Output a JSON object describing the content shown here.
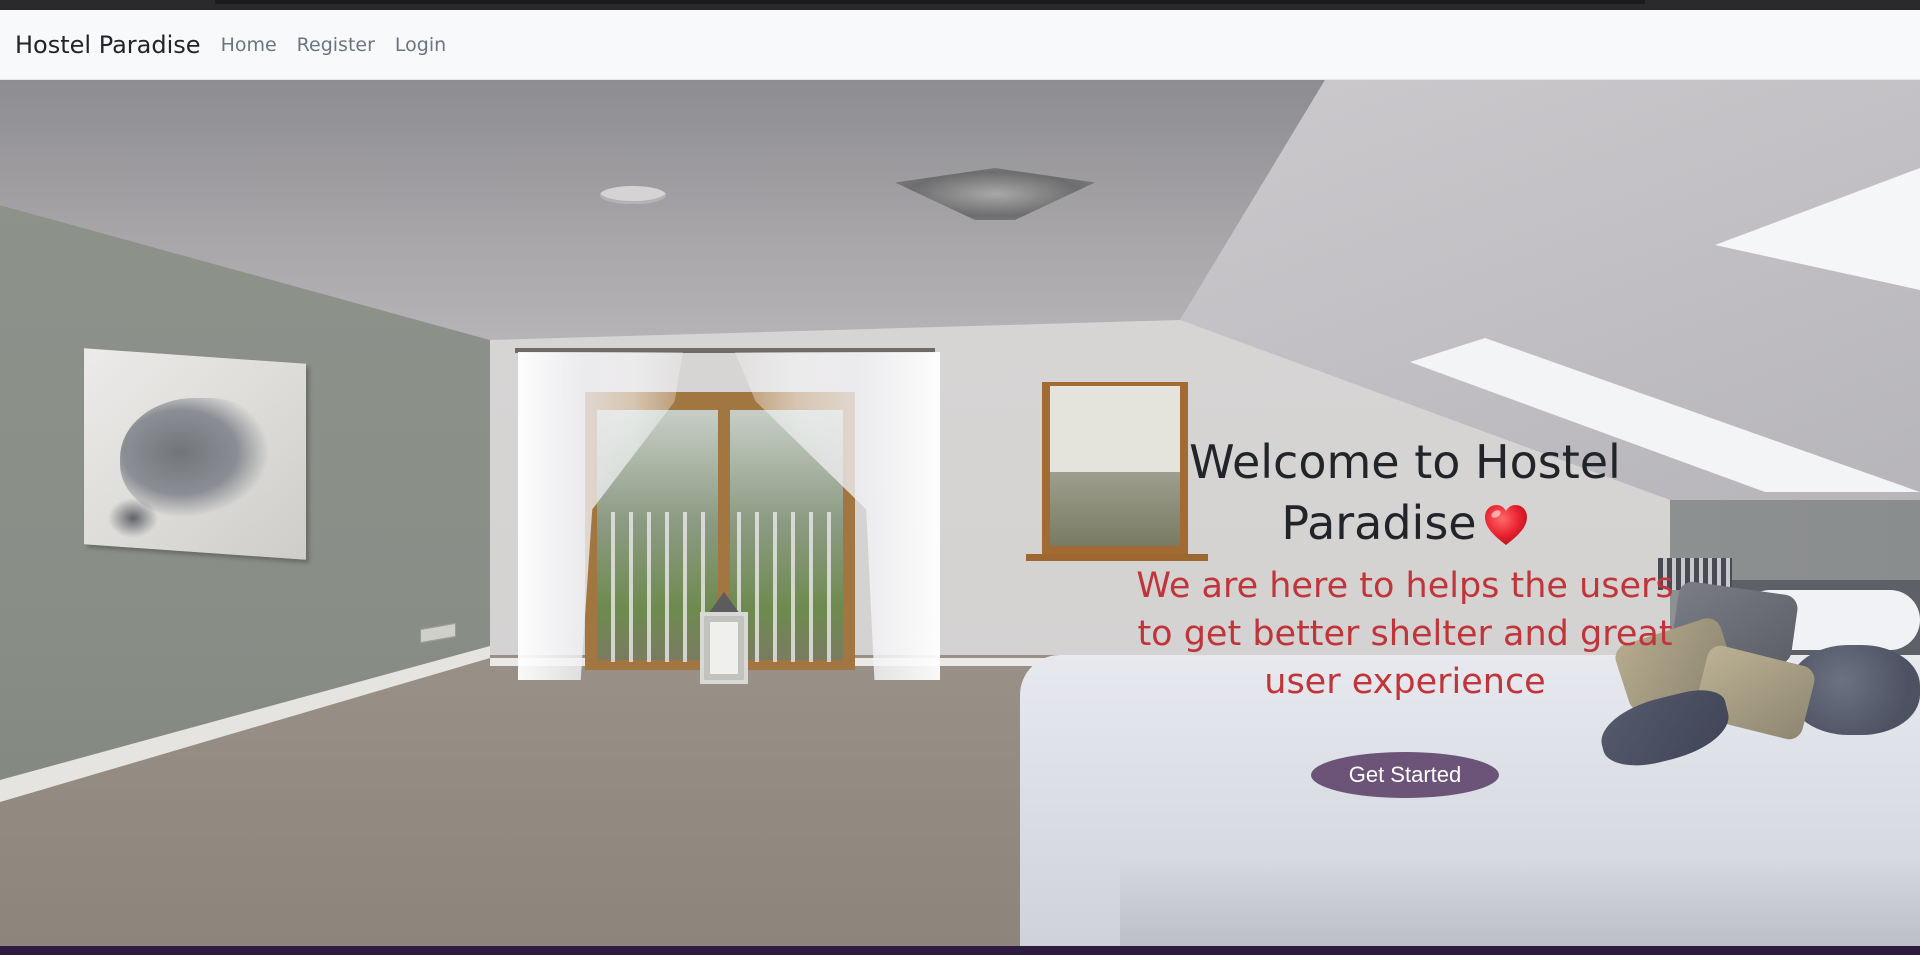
{
  "navbar": {
    "brand": "Hostel Paradise",
    "links": [
      {
        "label": "Home"
      },
      {
        "label": "Register"
      },
      {
        "label": "Login"
      }
    ]
  },
  "hero": {
    "title": "Welcome to Hostel Paradise",
    "heart_icon": "heart-emoji",
    "subtitle": "We are here to helps the users to get better shelter and great user experience",
    "cta_label": "Get Started"
  },
  "colors": {
    "navbar_bg": "#f8f9fa",
    "brand_text": "#212529",
    "nav_link": "#6c757d",
    "subtitle": "#c0353a",
    "cta_bg": "#6b5477",
    "cta_text": "#ffffff",
    "heart": "#e8212e"
  }
}
